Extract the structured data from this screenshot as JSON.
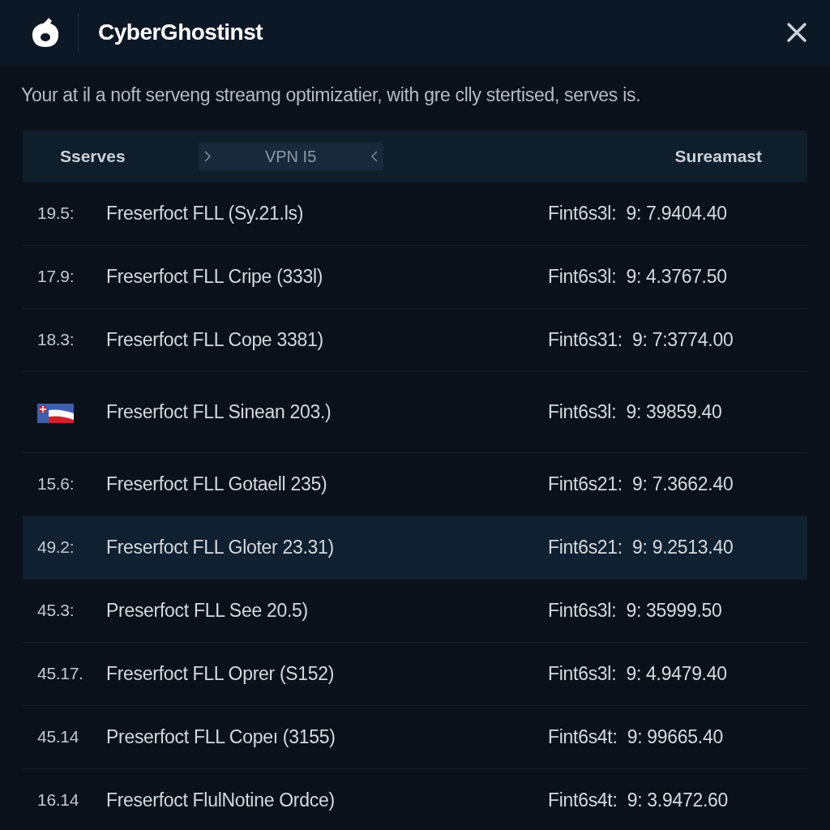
{
  "window": {
    "title": "CyberGhostinst"
  },
  "description": "Your at il a noft serveng streamg optimizatier, with gre clly stertised, serves is.",
  "table": {
    "columns": [
      {
        "label": "Sserves",
        "kind": "text"
      },
      {
        "label": "VPN I5",
        "kind": "pill"
      },
      {
        "label": "Sureamast",
        "kind": "text"
      }
    ],
    "rows": [
      {
        "kind": "number",
        "rank": "19.5:",
        "name": "Freserfoct FLL (Sy.21.ls)",
        "value": "Fint6s3l:  9: 7.9404.40",
        "selected": false
      },
      {
        "kind": "number",
        "rank": "17.9:",
        "name": "Freserfoct FLL Cripe (333l)",
        "value": "Fint6s3l:  9: 4.3767.50",
        "selected": false
      },
      {
        "kind": "number",
        "rank": "18.3:",
        "name": "Freserfoct FLL Cope 3381)",
        "value": "Fint6s31:  9: 7:3774.00",
        "selected": false
      },
      {
        "kind": "flag",
        "name": "Freserfoct FLL Sinean 203.)",
        "value": "Fint6s3l:  9: 39859.40",
        "selected": false
      },
      {
        "kind": "number",
        "rank": "15.6:",
        "name": "Freserfoct FLL Gotaell 235)",
        "value": "Fint6s21:  9: 7.3662.40",
        "selected": false
      },
      {
        "kind": "number",
        "rank": "49.2:",
        "name": "Freserfoct FLL Gloter 23.31)",
        "value": "Fint6s21:  9: 9.2513.40",
        "selected": true
      },
      {
        "kind": "number",
        "rank": "45.3:",
        "name": "Preserfoct FLL See 20.5)",
        "value": "Fint6s3l:  9: 35999.50",
        "selected": false
      },
      {
        "kind": "number",
        "rank": "45.17.",
        "name": "Freserfoct FLL Oprer (S152)",
        "value": "Fint6s3l:  9: 4.9479.40",
        "selected": false
      },
      {
        "kind": "number",
        "rank": "45.14",
        "name": "Preserfoct FLL Copeı (3155)",
        "value": "Fint6s4t:  9: 99665.40",
        "selected": false
      },
      {
        "kind": "number",
        "rank": "16.14",
        "name": "Freserfoct FlulNotine Ordce)",
        "value": "Fint6s4t:  9: 3.9472.60",
        "selected": false
      }
    ]
  }
}
